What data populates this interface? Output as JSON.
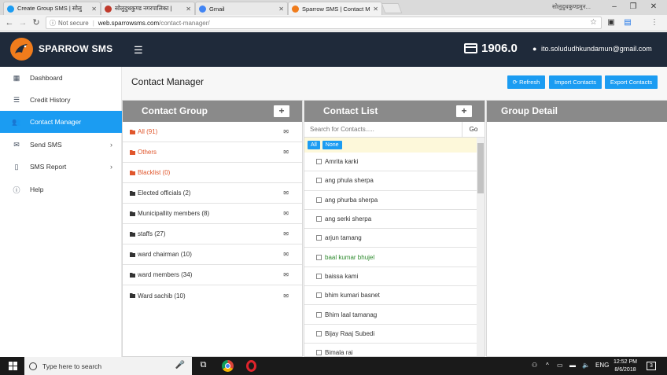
{
  "browser": {
    "tabs": [
      {
        "label": "Create Group SMS | सोलु",
        "color": "#1b9cf2"
      },
      {
        "label": "सोलुदुधकुण्ड नगरपालिका |",
        "color": "#c0392b"
      },
      {
        "label": "Gmail",
        "color": "#4285f4"
      },
      {
        "label": "Sparrow SMS | Contact M",
        "color": "#f07c1c"
      }
    ],
    "window_title": "सोलुदुधकुण्डमुन...",
    "insecure_label": "Not secure",
    "url_host": "web.sparrowsms.com",
    "url_path": "/contact-manager/"
  },
  "app": {
    "logo": "SPARROW SMS",
    "credit": "1906.0",
    "user_email": "ito.solududhkundamun@gmail.com"
  },
  "sidebar": {
    "items": [
      {
        "label": "Dashboard",
        "icon": "dashboard-icon"
      },
      {
        "label": "Credit History",
        "icon": "list-icon"
      },
      {
        "label": "Contact Manager",
        "icon": "users-icon"
      },
      {
        "label": "Send SMS",
        "icon": "envelope-icon"
      },
      {
        "label": "SMS Report",
        "icon": "file-icon"
      },
      {
        "label": "Help",
        "icon": "info-icon"
      }
    ]
  },
  "main": {
    "title": "Contact Manager",
    "buttons": {
      "refresh": "Refresh",
      "import": "Import Contacts",
      "export": "Export Contacts"
    }
  },
  "contact_group": {
    "title": "Contact Group",
    "plus": "+",
    "groups": [
      {
        "label": "All (91)",
        "color": "#e0562c"
      },
      {
        "label": "Others",
        "color": "#e0562c"
      },
      {
        "label": "Blacklist (0)",
        "color": "#e0562c"
      },
      {
        "label": "Elected officials (2)",
        "color": "#333333"
      },
      {
        "label": "Municipallity members (8)",
        "color": "#333333"
      },
      {
        "label": "staffs (27)",
        "color": "#333333"
      },
      {
        "label": "ward chairman (10)",
        "color": "#333333"
      },
      {
        "label": "ward members (34)",
        "color": "#333333"
      },
      {
        "label": "Ward sachib (10)",
        "color": "#333333"
      }
    ]
  },
  "contact_list": {
    "title": "Contact List",
    "plus": "+",
    "search_placeholder": "Search for Contacts.....",
    "go": "Go",
    "filter_all": "All",
    "filter_none": "None",
    "contacts": [
      {
        "name": "Amrita karki",
        "color": "#333333"
      },
      {
        "name": "ang phula sherpa",
        "color": "#333333"
      },
      {
        "name": "ang phurba sherpa",
        "color": "#333333"
      },
      {
        "name": "ang serki sherpa",
        "color": "#333333"
      },
      {
        "name": "arjun tamang",
        "color": "#333333"
      },
      {
        "name": "baal kumar bhujel",
        "color": "#2e8b2e"
      },
      {
        "name": "baissa kami",
        "color": "#333333"
      },
      {
        "name": "bhim kumari basnet",
        "color": "#333333"
      },
      {
        "name": "Bhim laal tamanag",
        "color": "#333333"
      },
      {
        "name": "Bijay Raaj Subedi",
        "color": "#333333"
      },
      {
        "name": "Bimala rai",
        "color": "#333333"
      }
    ]
  },
  "group_detail": {
    "title": "Group Detail"
  },
  "taskbar": {
    "search": "Type here to search",
    "lang": "ENG",
    "time": "12:52 PM",
    "date": "8/6/2018",
    "notifications": "3"
  }
}
